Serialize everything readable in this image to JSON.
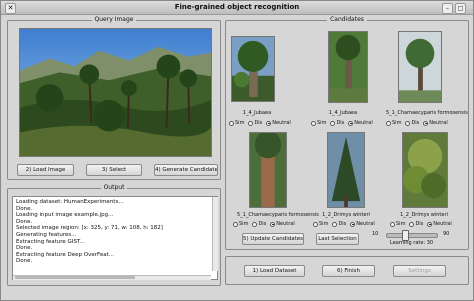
{
  "window": {
    "title": "Fine-grained object recognition",
    "close_glyph": "✕"
  },
  "query": {
    "title": "Query Image",
    "buttons": {
      "load": "2) Load Image",
      "select": "3) Select",
      "generate": "4) Generate Candidates"
    }
  },
  "output": {
    "title": "Output",
    "lines": [
      "Loading dataset: HumanExperiments...",
      "Done.",
      "Loading input image example.jpg...",
      "Done.",
      "Selected image region: [x: 325, y: 71, w: 108, h: 182]",
      "Generating features...",
      "Extracting feature GIST...",
      "Done.",
      "Extracting feature Deep OverFeat...",
      "Done."
    ]
  },
  "candidates": {
    "title": "Candidates",
    "radio_labels": {
      "sim": "Sim",
      "dis": "Dis",
      "neutral": "Neutral"
    },
    "items": [
      {
        "label": "1_4_Jubaea",
        "selected": "Neutral"
      },
      {
        "label": "1_4_Jubaea",
        "selected": "Neutral"
      },
      {
        "label": "5_1_Chamaecyparis formosensis",
        "selected": "Neutral"
      },
      {
        "label": "5_1_Chamaecyparis formosensis",
        "selected": "Neutral"
      },
      {
        "label": "1_2_Drimys winteri",
        "selected": "Neutral"
      },
      {
        "label": "1_2_Drimys winteri",
        "selected": "Neutral"
      }
    ],
    "buttons": {
      "update": "5) Update Candidates",
      "last": "Last Selection"
    },
    "slider": {
      "min": "10",
      "max": "90",
      "value": 30,
      "label": "Learning rate: 30"
    }
  },
  "bottom": {
    "load_dataset": "1) Load Dataset",
    "finish": "6) Finish",
    "settings": "Settings"
  }
}
